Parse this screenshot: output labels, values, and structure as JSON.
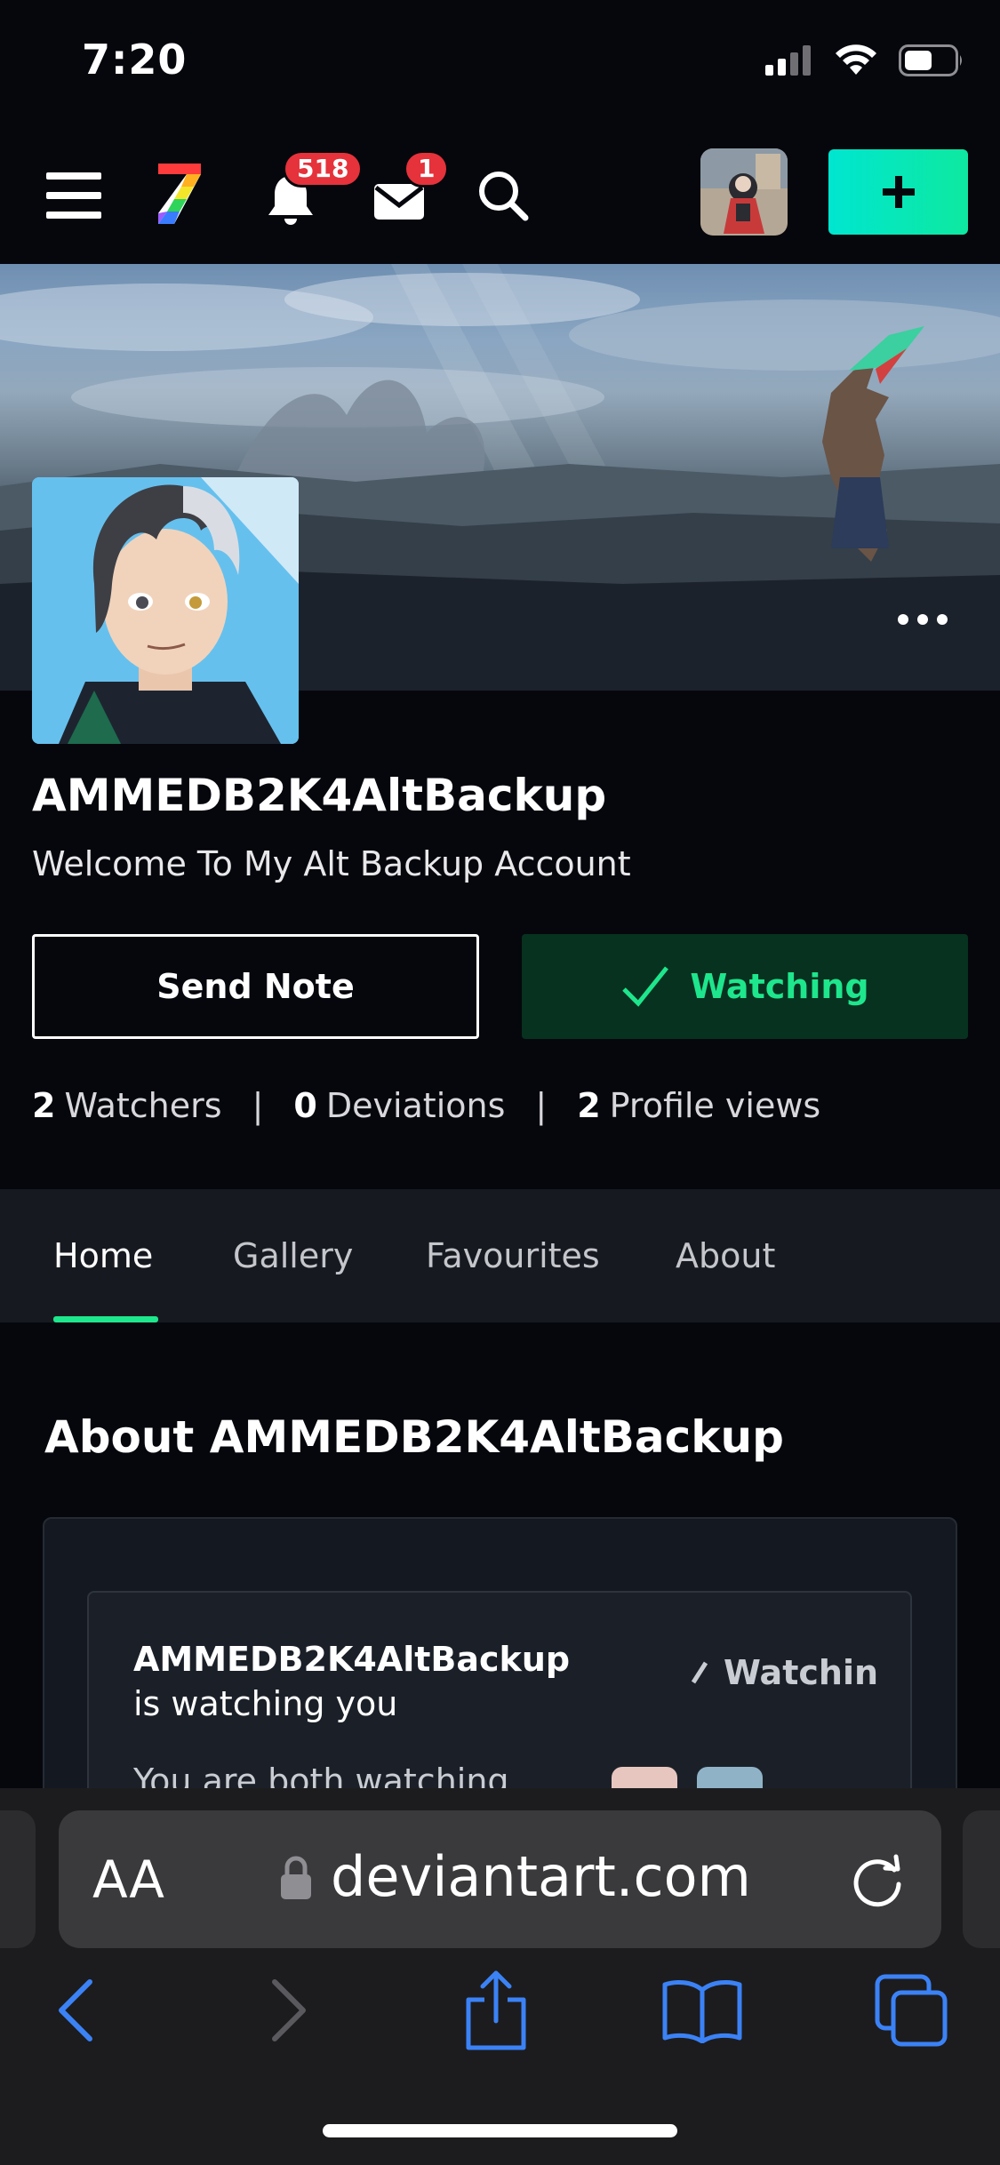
{
  "status_bar": {
    "time": "7:20",
    "icons": [
      "cellular-signal-icon",
      "wifi-icon",
      "battery-icon"
    ]
  },
  "nav": {
    "notifications_count": "518",
    "messages_count": "1",
    "icons": [
      "hamburger-menu-icon",
      "deviantart-logo-icon",
      "bell-icon",
      "envelope-icon",
      "search-icon",
      "plus-icon"
    ],
    "accent_color": "#00e6d0"
  },
  "profile": {
    "username": "AMMEDB2K4AltBackup",
    "tagline": "Welcome To My Alt Backup Account",
    "send_note_label": "Send Note",
    "watching_label": "Watching",
    "stats": {
      "watchers_count": "2",
      "watchers_label": "Watchers",
      "deviations_count": "0",
      "deviations_label": "Deviations",
      "views_count": "2",
      "views_label": "Profile views",
      "separator": "|"
    }
  },
  "tabs": [
    {
      "label": "Home",
      "active": true
    },
    {
      "label": "Gallery",
      "active": false
    },
    {
      "label": "Favourites",
      "active": false
    },
    {
      "label": "About",
      "active": false
    }
  ],
  "about": {
    "heading": "About AMMEDB2K4AltBackup",
    "watch_card": {
      "username": "AMMEDB2K4AltBackup",
      "text_suffix": " is watching you",
      "status_label": "Watchin",
      "sub_text": "You are both watching"
    }
  },
  "browser": {
    "aa_label": "AA",
    "url": "deviantart.com",
    "toolbar_icons": [
      "back-icon",
      "forward-icon",
      "share-icon",
      "bookmarks-icon",
      "tabs-icon"
    ],
    "link_color": "#3b82f6"
  }
}
